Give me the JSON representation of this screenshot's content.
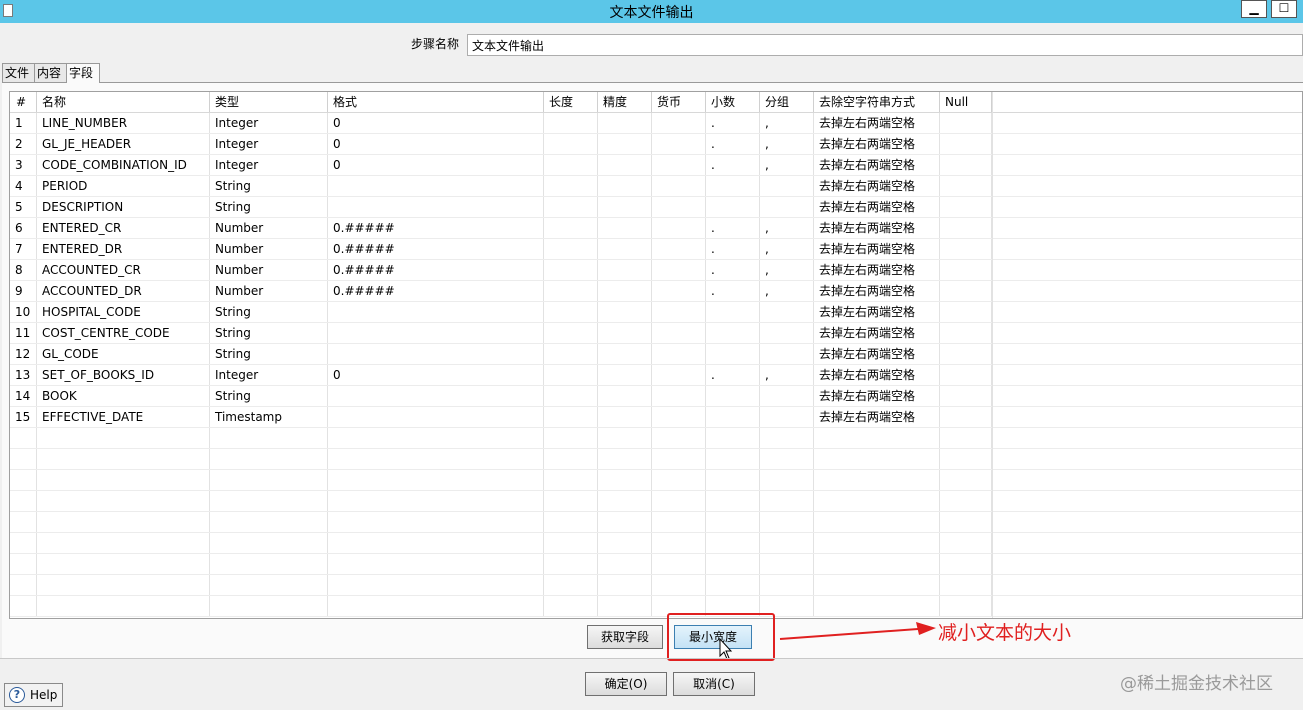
{
  "window": {
    "title": "文本文件输出",
    "minimize_label": "▁",
    "maximize_label": "☐"
  },
  "step": {
    "label": "步骤名称",
    "value": "文本文件输出"
  },
  "tabs": [
    {
      "label": "文件"
    },
    {
      "label": "内容"
    },
    {
      "label": "字段"
    }
  ],
  "table": {
    "headers": [
      "#",
      "名称",
      "类型",
      "格式",
      "长度",
      "精度",
      "货币",
      "小数",
      "分组",
      "去除空字符串方式",
      "Null"
    ],
    "rows": [
      [
        "1",
        "LINE_NUMBER",
        "Integer",
        "0",
        "",
        "",
        "",
        ".",
        ",",
        "去掉左右两端空格",
        ""
      ],
      [
        "2",
        "GL_JE_HEADER",
        "Integer",
        "0",
        "",
        "",
        "",
        ".",
        ",",
        "去掉左右两端空格",
        ""
      ],
      [
        "3",
        "CODE_COMBINATION_ID",
        "Integer",
        "0",
        "",
        "",
        "",
        ".",
        ",",
        "去掉左右两端空格",
        ""
      ],
      [
        "4",
        "PERIOD",
        "String",
        "",
        "",
        "",
        "",
        "",
        "",
        "去掉左右两端空格",
        ""
      ],
      [
        "5",
        "DESCRIPTION",
        "String",
        "",
        "",
        "",
        "",
        "",
        "",
        "去掉左右两端空格",
        ""
      ],
      [
        "6",
        "ENTERED_CR",
        "Number",
        "0.#####",
        "",
        "",
        "",
        ".",
        ",",
        "去掉左右两端空格",
        ""
      ],
      [
        "7",
        "ENTERED_DR",
        "Number",
        "0.#####",
        "",
        "",
        "",
        ".",
        ",",
        "去掉左右两端空格",
        ""
      ],
      [
        "8",
        "ACCOUNTED_CR",
        "Number",
        "0.#####",
        "",
        "",
        "",
        ".",
        ",",
        "去掉左右两端空格",
        ""
      ],
      [
        "9",
        "ACCOUNTED_DR",
        "Number",
        "0.#####",
        "",
        "",
        "",
        ".",
        ",",
        "去掉左右两端空格",
        ""
      ],
      [
        "10",
        "HOSPITAL_CODE",
        "String",
        "",
        "",
        "",
        "",
        "",
        "",
        "去掉左右两端空格",
        ""
      ],
      [
        "11",
        "COST_CENTRE_CODE",
        "String",
        "",
        "",
        "",
        "",
        "",
        "",
        "去掉左右两端空格",
        ""
      ],
      [
        "12",
        "GL_CODE",
        "String",
        "",
        "",
        "",
        "",
        "",
        "",
        "去掉左右两端空格",
        ""
      ],
      [
        "13",
        "SET_OF_BOOKS_ID",
        "Integer",
        "0",
        "",
        "",
        "",
        ".",
        ",",
        "去掉左右两端空格",
        ""
      ],
      [
        "14",
        "BOOK",
        "String",
        "",
        "",
        "",
        "",
        "",
        "",
        "去掉左右两端空格",
        ""
      ],
      [
        "15",
        "EFFECTIVE_DATE",
        "Timestamp",
        "",
        "",
        "",
        "",
        "",
        "",
        "去掉左右两端空格",
        ""
      ]
    ]
  },
  "buttons": {
    "get_fields": "获取字段",
    "min_width": "最小宽度",
    "ok": "确定(O)",
    "cancel": "取消(C)",
    "help": "Help"
  },
  "annotation": {
    "text": "减小文本的大小",
    "color": "#e02020"
  },
  "watermark": "@稀土掘金技术社区"
}
